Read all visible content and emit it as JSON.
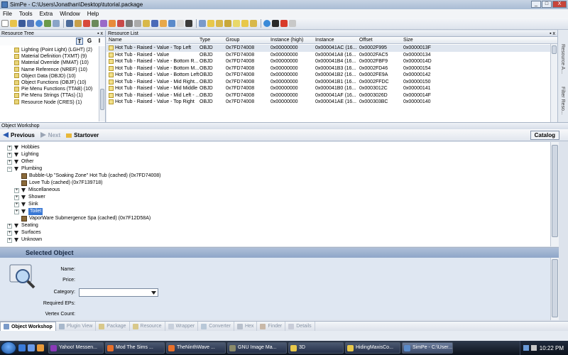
{
  "window": {
    "title": "SimPe - C:\\Users\\Jonathan\\Desktop\\tutorial.package",
    "min": "_",
    "max": "□",
    "close": "X"
  },
  "menu": [
    "File",
    "Tools",
    "Extra",
    "Window",
    "Help"
  ],
  "resource_tree": {
    "title": "Resource Tree",
    "pin": "▪ x",
    "mode_buttons": [
      "T",
      "G",
      "I"
    ],
    "items": [
      "Lighting (Point Light) (LGHT) (2)",
      "Material Definition (TXMT) (9)",
      "Material Override (MMAT) (10)",
      "Name Reference (NREF) (10)",
      "Object Data (OBJD) (10)",
      "Object Functions (OBJF) (10)",
      "Pie Menu Functions (TTAB) (10)",
      "Pie Menu Strings (TTAs) (1)",
      "Resource Node (CRES) (1)"
    ]
  },
  "resource_list": {
    "title": "Resource List",
    "pin": "▪ x",
    "columns": [
      "Name",
      "Type",
      "Group",
      "Instance (high)",
      "Instance",
      "Offset",
      "Size"
    ],
    "rows": [
      [
        "Hot Tub - Raised - Value - Top Left",
        "OBJD",
        "0x7FD74008",
        "0x00000000",
        "0x000041AC (16...",
        "0x0002F995",
        "0x0000013F"
      ],
      [
        "Hot Tub - Raised - Value",
        "OBJD",
        "0x7FD74008",
        "0x00000000",
        "0x000041A8 (16...",
        "0x0002FAC5",
        "0x00000134"
      ],
      [
        "Hot Tub - Raised - Value - Bottom R...",
        "OBJD",
        "0x7FD74008",
        "0x00000000",
        "0x000041B4 (16...",
        "0x0002FBF9",
        "0x0000014D"
      ],
      [
        "Hot Tub - Raised - Value - Bottom M...",
        "OBJD",
        "0x7FD74008",
        "0x00000000",
        "0x000041B3 (16...",
        "0x0002FD46",
        "0x00000154"
      ],
      [
        "Hot Tub - Raised - Value - Bottom Left",
        "OBJD",
        "0x7FD74008",
        "0x00000000",
        "0x000041B2 (16...",
        "0x0002FE9A",
        "0x00000142"
      ],
      [
        "Hot Tub - Raised - Value - Mid Right...",
        "OBJD",
        "0x7FD74008",
        "0x00000000",
        "0x000041B1 (16...",
        "0x0002FFDC",
        "0x00000150"
      ],
      [
        "Hot Tub - Raised - Value - Mid Middle",
        "OBJD",
        "0x7FD74008",
        "0x00000000",
        "0x000041B0 (16...",
        "0x0003012C",
        "0x00000141"
      ],
      [
        "Hot Tub - Raised - Value - Mid Left - ...",
        "OBJD",
        "0x7FD74008",
        "0x00000000",
        "0x000041AF (16...",
        "0x0003026D",
        "0x0000014F"
      ],
      [
        "Hot Tub - Raised - Value - Top Right",
        "OBJD",
        "0x7FD74008",
        "0x00000000",
        "0x000041AE (16...",
        "0x000303BC",
        "0x00000140"
      ]
    ]
  },
  "right_side_tabs": [
    "Resource A...",
    "Filter Reso..."
  ],
  "object_workshop": {
    "title": "Object Workshop",
    "nav": {
      "previous": "Previous",
      "next": "Next",
      "startover": "Startover",
      "catalog": "Catalog"
    },
    "tree": [
      {
        "label": "Hobbies",
        "level": 0
      },
      {
        "label": "Lighting",
        "level": 0
      },
      {
        "label": "Other",
        "level": 0
      },
      {
        "label": "Plumbing",
        "level": 0
      },
      {
        "label": "Bubble-Up \"Soaking Zone\" Hot Tub (cached) (0x7FD74008)",
        "level": 1,
        "kind": "obj"
      },
      {
        "label": "Love Tub (cached) (0x7F139718)",
        "level": 1,
        "kind": "obj"
      },
      {
        "label": "Miscellaneous",
        "level": 1
      },
      {
        "label": "Shower",
        "level": 1
      },
      {
        "label": "Sink",
        "level": 1
      },
      {
        "label": "Toilet",
        "level": 1,
        "selected": true
      },
      {
        "label": "VaporWare Submergence Spa (cached) (0x7F12D58A)",
        "level": 1,
        "kind": "obj"
      },
      {
        "label": "Seating",
        "level": 0
      },
      {
        "label": "Surfaces",
        "level": 0
      },
      {
        "label": "Unknown",
        "level": 0
      }
    ]
  },
  "selected_object": {
    "title": "Selected Object",
    "fields": {
      "name": "Name:",
      "price": "Price:",
      "category": "Category:",
      "required_eps": "Required EPs:",
      "vertex_count": "Vertex Count:"
    },
    "category_value": ""
  },
  "bottom_tabs": [
    "Object Workshop",
    "Plugin View",
    "Package",
    "Resource",
    "Wrapper",
    "Converter",
    "Hex",
    "Finder",
    "Details"
  ],
  "taskbar": {
    "tasks": [
      "Yahoo! Messen...",
      "Mod The Sims ...",
      "TheNinthWave ...",
      "GNU Image Ma...",
      "3D",
      "HidingMaxisCo...",
      "SimPe - C:\\User..."
    ],
    "clock": "10:22 PM"
  }
}
